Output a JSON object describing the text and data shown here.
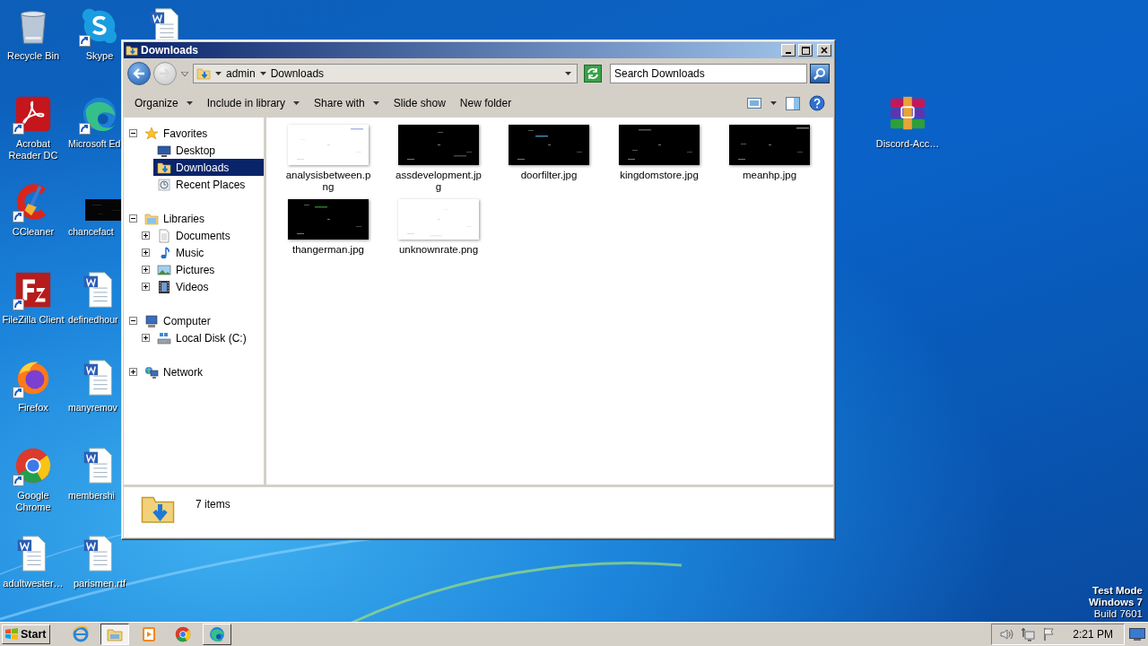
{
  "desktop": {
    "icons": [
      {
        "label": "Recycle Bin",
        "kind": "recycle",
        "shortcut": false
      },
      {
        "label": "Acrobat Reader DC",
        "kind": "acrobat",
        "shortcut": true
      },
      {
        "label": "CCleaner",
        "kind": "ccleaner",
        "shortcut": true
      },
      {
        "label": "FileZilla Client",
        "kind": "filezilla",
        "shortcut": true
      },
      {
        "label": "Firefox",
        "kind": "firefox",
        "shortcut": true
      },
      {
        "label": "Google Chrome",
        "kind": "chrome",
        "shortcut": true
      },
      {
        "label": "adultwester…",
        "kind": "word",
        "shortcut": false
      },
      {
        "label": "Skype",
        "kind": "skype",
        "shortcut": true
      },
      {
        "label": "Microsoft Ed",
        "kind": "edge",
        "shortcut": true
      },
      {
        "label": "chancefact",
        "shortcut": false
      },
      {
        "label": "definedhour",
        "kind": "word",
        "shortcut": false
      },
      {
        "label": "manyremov",
        "kind": "word",
        "shortcut": false
      },
      {
        "label": "membershi",
        "kind": "word",
        "shortcut": false
      },
      {
        "label": "parismen.rtf",
        "kind": "word",
        "shortcut": false
      },
      {
        "kind": "word",
        "shortcut": false
      },
      {
        "label": "Discord-Acc…",
        "kind": "archive",
        "shortcut": false
      }
    ],
    "os_notice": [
      "Test Mode",
      "Windows 7",
      "Build 7601"
    ]
  },
  "window": {
    "title": "Downloads",
    "address": {
      "breadcrumbs": [
        "admin",
        "Downloads"
      ]
    },
    "search": {
      "placeholder": "Search Downloads"
    },
    "toolbar": [
      {
        "label": "Organize",
        "dropdown": true
      },
      {
        "label": "Include in library",
        "dropdown": true
      },
      {
        "label": "Share with",
        "dropdown": true
      },
      {
        "label": "Slide show",
        "dropdown": false
      },
      {
        "label": "New folder",
        "dropdown": false
      }
    ],
    "nav": [
      {
        "label": "Favorites",
        "kind": "favorites",
        "expanded": true,
        "selected": false,
        "children": [
          {
            "label": "Desktop",
            "kind": "desktop",
            "selected": false
          },
          {
            "label": "Downloads",
            "kind": "downloads",
            "selected": true
          },
          {
            "label": "Recent Places",
            "kind": "recent",
            "selected": false
          }
        ]
      },
      {
        "label": "Libraries",
        "kind": "libraries",
        "expanded": true,
        "selected": false,
        "children": [
          {
            "label": "Documents",
            "kind": "documents",
            "expanded": false,
            "selected": false
          },
          {
            "label": "Music",
            "kind": "music",
            "expanded": false,
            "selected": false
          },
          {
            "label": "Pictures",
            "kind": "pictures",
            "expanded": false,
            "selected": false
          },
          {
            "label": "Videos",
            "kind": "videos",
            "expanded": false,
            "selected": false
          }
        ]
      },
      {
        "label": "Computer",
        "kind": "computer",
        "expanded": true,
        "selected": false,
        "children": [
          {
            "label": "Local Disk (C:)",
            "kind": "drive",
            "expanded": false,
            "selected": false
          }
        ]
      },
      {
        "label": "Network",
        "kind": "network",
        "expanded": false,
        "selected": false
      }
    ],
    "files": [
      {
        "name": "analysisbetween.png",
        "kind": "picture"
      },
      {
        "name": "assdevelopment.jpg",
        "kind": "picture"
      },
      {
        "name": "doorfilter.jpg",
        "kind": "picture"
      },
      {
        "name": "kingdomstore.jpg",
        "kind": "picture"
      },
      {
        "name": "meanhp.jpg",
        "kind": "picture"
      },
      {
        "name": "thangerman.jpg",
        "kind": "picture"
      },
      {
        "name": "unknownrate.png",
        "kind": "picture"
      }
    ],
    "details": {
      "summary": "7 items"
    }
  },
  "taskbar": {
    "start": "Start",
    "apps": [
      {
        "kind": "ie",
        "open": false,
        "selected": false
      },
      {
        "kind": "explorer",
        "open": true,
        "selected": true
      },
      {
        "kind": "media",
        "open": false,
        "selected": false
      },
      {
        "kind": "chrome",
        "open": false,
        "selected": false
      },
      {
        "kind": "edge",
        "open": true,
        "selected": false
      }
    ],
    "tray": {
      "time": "2:21 PM"
    }
  }
}
